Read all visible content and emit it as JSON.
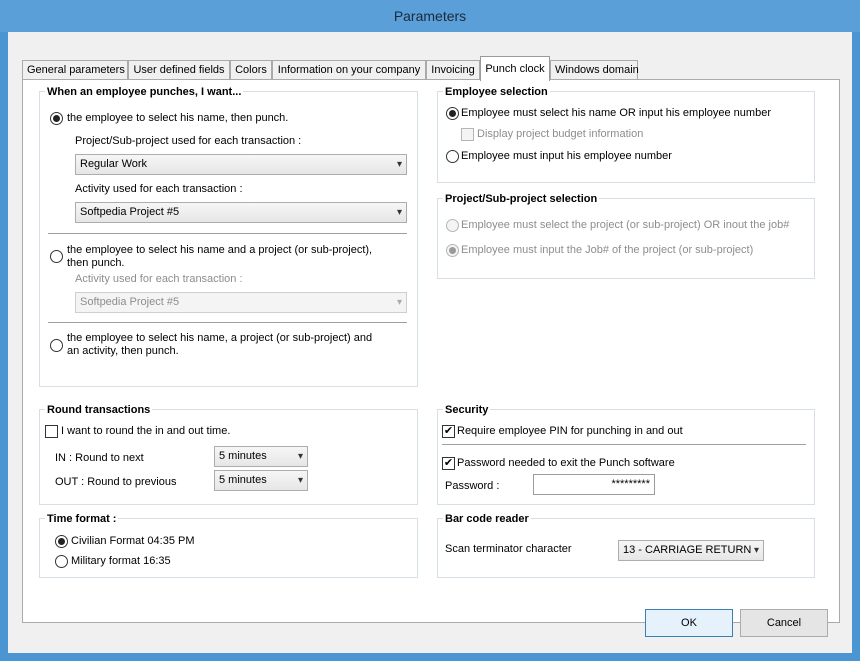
{
  "window": {
    "title": "Parameters"
  },
  "tabs": [
    {
      "label": "General parameters"
    },
    {
      "label": "User defined fields"
    },
    {
      "label": "Colors"
    },
    {
      "label": "Information on your company"
    },
    {
      "label": "Invoicing"
    },
    {
      "label": "Punch clock"
    },
    {
      "label": "Windows domain"
    }
  ],
  "active_tab": "Punch clock",
  "punch": {
    "title": "When an employee punches, I want...",
    "opt1": "the employee to select his name, then punch.",
    "project_label": "Project/Sub-project used for each transaction :",
    "project_value": "Regular Work",
    "activity_label": "Activity used for each transaction :",
    "activity_value": "Softpedia Project #5",
    "opt2_line1": "the employee to select his name and a project (or sub-project),",
    "opt2_line2": "then punch.",
    "activity2_label": "Activity used for each transaction :",
    "activity2_value": "Softpedia Project #5",
    "opt3_line1": "the employee to select his name, a project (or sub-project) and",
    "opt3_line2": "an activity, then punch."
  },
  "employee_selection": {
    "title": "Employee selection",
    "opt1": "Employee must select his name OR input his employee number",
    "budget": "Display project budget information",
    "opt2": "Employee must input his employee number"
  },
  "project_selection": {
    "title": "Project/Sub-project selection",
    "opt1": "Employee must select the project (or sub-project) OR inout the job#",
    "opt2": "Employee must input the Job# of the project (or sub-project)"
  },
  "round": {
    "title": "Round transactions",
    "check_label": "I want to round the in and out time.",
    "in_label": "IN : Round to next",
    "in_value": "5 minutes",
    "out_label": "OUT : Round to previous",
    "out_value": "5 minutes"
  },
  "security": {
    "title": "Security",
    "pin_label": "Require employee PIN for punching in and out",
    "password_needed_label": "Password needed to exit the Punch software",
    "password_label": "Password :",
    "password_value": "*********"
  },
  "time_format": {
    "title": "Time format :",
    "civilian": "Civilian Format 04:35 PM",
    "military": "Military format 16:35"
  },
  "barcode": {
    "title": "Bar code reader",
    "label": "Scan terminator character",
    "value": "13 - CARRIAGE RETURN"
  },
  "buttons": {
    "ok": "OK",
    "cancel": "Cancel"
  },
  "icons": {
    "checkmark": "✔",
    "dropdown": "▾"
  }
}
